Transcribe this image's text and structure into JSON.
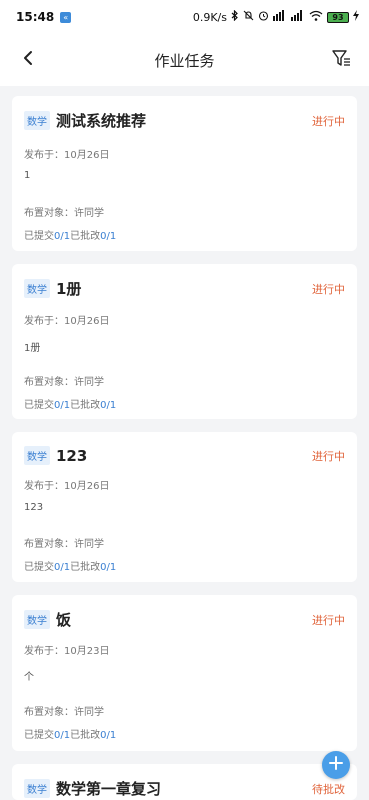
{
  "status_bar": {
    "time": "15:48",
    "app_badge": "«",
    "speed": "0.9K/s",
    "battery_level": "93",
    "icons": [
      "bluetooth-icon",
      "mute-icon",
      "alarm-icon",
      "volte-icon",
      "signal-icon",
      "wifi-icon",
      "battery-icon",
      "charging-icon"
    ]
  },
  "header": {
    "title": "作业任务",
    "back_icon": "chevron-left-icon",
    "filter_icon": "filter-list-icon"
  },
  "cards": [
    {
      "subject": "数学",
      "title": "测试系统推荐",
      "status": "进行中",
      "published_label": "发布于：",
      "published_date": "10月26日",
      "content": "1",
      "target_label": "布置对象：",
      "target": "许同学",
      "submitted_label": "已提交",
      "submitted": "0/1",
      "graded_label": "已批改",
      "graded": "0/1"
    },
    {
      "subject": "数学",
      "title": "1册",
      "status": "进行中",
      "published_label": "发布于：",
      "published_date": "10月26日",
      "content": "1册",
      "target_label": "布置对象：",
      "target": "许同学",
      "submitted_label": "已提交",
      "submitted": "0/1",
      "graded_label": "已批改",
      "graded": "0/1"
    },
    {
      "subject": "数学",
      "title": "123",
      "status": "进行中",
      "published_label": "发布于：",
      "published_date": "10月26日",
      "content": "123",
      "target_label": "布置对象：",
      "target": "许同学",
      "submitted_label": "已提交",
      "submitted": "0/1",
      "graded_label": "已批改",
      "graded": "0/1"
    },
    {
      "subject": "数学",
      "title": "饭",
      "status": "进行中",
      "published_label": "发布于：",
      "published_date": "10月23日",
      "content": "个",
      "target_label": "布置对象：",
      "target": "许同学",
      "submitted_label": "已提交",
      "submitted": "0/1",
      "graded_label": "已批改",
      "graded": "0/1"
    },
    {
      "subject": "数学",
      "title": "数学第一章复习",
      "status": "待批改"
    }
  ],
  "fab": {
    "icon": "plus-icon"
  },
  "colors": {
    "accent_blue": "#3a7fd1",
    "status_orange": "#e0633a",
    "background": "#f3f4f6"
  }
}
